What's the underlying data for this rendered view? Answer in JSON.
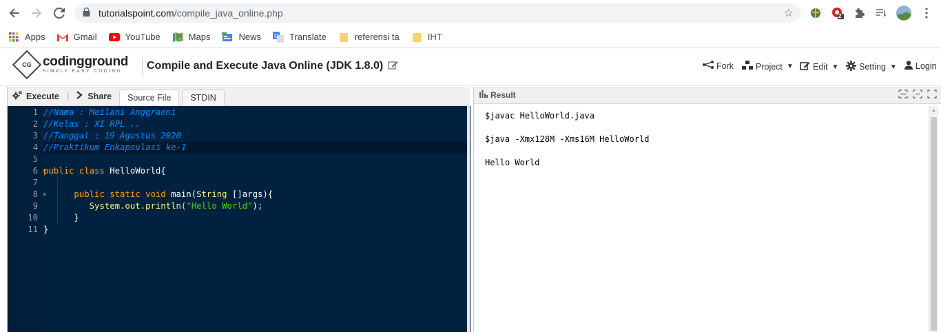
{
  "browser": {
    "url_host": "tutorialspoint.com",
    "url_path": "/compile_java_online.php",
    "extension_badge": "2"
  },
  "bookmarks": [
    {
      "label": "Apps",
      "icon": "apps-grid-icon"
    },
    {
      "label": "Gmail",
      "icon": "gmail-icon"
    },
    {
      "label": "YouTube",
      "icon": "youtube-icon"
    },
    {
      "label": "Maps",
      "icon": "maps-icon"
    },
    {
      "label": "News",
      "icon": "news-icon"
    },
    {
      "label": "Translate",
      "icon": "translate-icon"
    },
    {
      "label": "referensi ta",
      "icon": "folder-icon"
    },
    {
      "label": "IHT",
      "icon": "folder-icon"
    }
  ],
  "site": {
    "logo_main": "codingground",
    "logo_tagline": "SIMPLY EASY CODING",
    "title": "Compile and Execute Java Online (JDK 1.8.0)",
    "menu": {
      "fork": "Fork",
      "project": "Project",
      "edit": "Edit",
      "setting": "Setting",
      "login": "Login"
    }
  },
  "editor": {
    "execute": "Execute",
    "share": "Share",
    "tabs": [
      "Source File",
      "STDIN"
    ],
    "line_numbers": [
      "1",
      "2",
      "3",
      "4",
      "5",
      "6",
      "7",
      "8",
      "9",
      "10",
      "11"
    ],
    "code": {
      "l1": "//Nama : Meilani Anggraeni",
      "l2": "//Kelas : XI RPL ..",
      "l3": "//Tanggal : 19 Agustus 2020",
      "l4": "//Praktikum Enkapsulasi ke-1",
      "l6_kw": "public class ",
      "l6_name": "HelloWorld{",
      "l8_kw": "public static void ",
      "l8_name": "main(",
      "l8_type": "String",
      "l8_rest": " []args){",
      "l9_pre": "System.out.println(",
      "l9_str": "\"Hello World\"",
      "l9_post": ");",
      "l10": "}",
      "l11": "}"
    }
  },
  "result": {
    "title": "Result",
    "lines": [
      "$javac HelloWorld.java",
      "",
      "$java -Xmx128M -Xms16M HelloWorld",
      "",
      "Hello World"
    ]
  },
  "colors": {
    "editor_bg": "#002240",
    "comment": "#0088ff",
    "keyword": "#ff9d00",
    "string": "#3ad900"
  }
}
